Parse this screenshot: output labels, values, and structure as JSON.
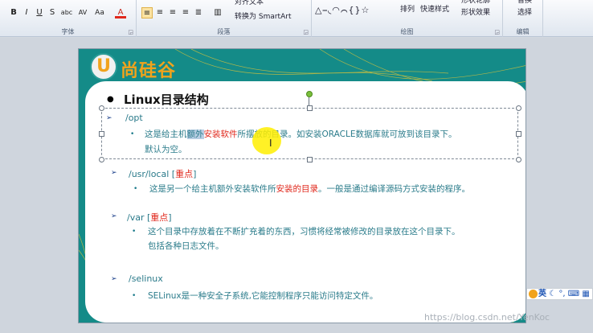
{
  "ribbon": {
    "groups": [
      {
        "id": "font",
        "label": "字体"
      },
      {
        "id": "paragraph",
        "label": "段落"
      },
      {
        "id": "drawing",
        "label": "绘图"
      },
      {
        "id": "editing",
        "label": "编辑"
      }
    ],
    "align_text": "对齐文本",
    "convert_smartart": "转换为 SmartArt",
    "arrange": "排列",
    "quick_styles": "快速样式",
    "shape_outline": "形状轮廓",
    "shape_effects": "形状效果",
    "replace": "替换",
    "select": "选择",
    "font_buttons": [
      "B",
      "I",
      "U",
      "S",
      "abc",
      "AV",
      "Aa",
      "A"
    ]
  },
  "slide": {
    "logo_text": "尚硅谷",
    "logo_letter": "U",
    "title": "Linux目录结构",
    "sections": [
      {
        "path": "/opt",
        "tag": "",
        "lines": [
          "这是给主机额外安装软件所摆放的目录。如安装ORACLE数据库就可放到该目录下。",
          "默认为空。"
        ]
      },
      {
        "path": "/usr/local",
        "tag": "重点",
        "lines": [
          "这是另一个给主机额外安装软件所安装的目录。一般是通过编译源码方式安装的程序。"
        ]
      },
      {
        "path": "/var",
        "tag": "重点",
        "lines": [
          "这个目录中存放着在不断扩充着的东西，习惯将经常被修改的目录放在这个目录下。",
          "包括各种日志文件。"
        ]
      },
      {
        "path": "/selinux",
        "tag": "",
        "lines": [
          "SELinux是一种安全子系统,它能控制程序只能访问特定文件。"
        ]
      }
    ]
  },
  "ime": {
    "label": "英"
  },
  "watermark": "https://blog.csdn.net/YenKoc",
  "colors": {
    "teal": "#148b88",
    "accent_orange": "#f1a31c",
    "red": "#e0281c",
    "body_text": "#2b7c8b"
  }
}
